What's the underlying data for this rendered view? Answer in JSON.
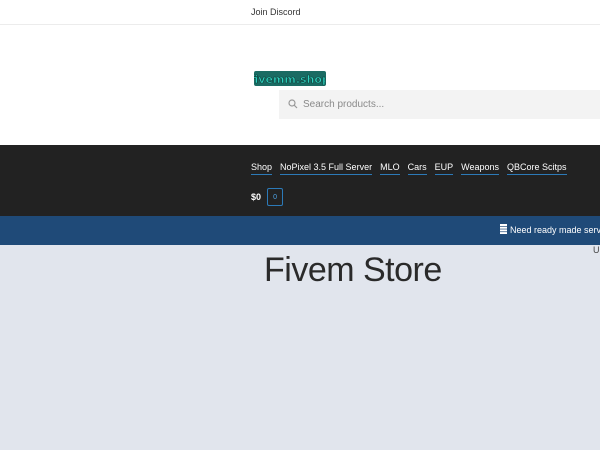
{
  "topbar": {
    "discord_label": "Join Discord"
  },
  "header": {
    "logo_text": "fivemm.shop",
    "search_placeholder": "Search products..."
  },
  "nav": {
    "items": [
      {
        "label": "Shop"
      },
      {
        "label": "NoPixel 3.5 Full Server"
      },
      {
        "label": "MLO"
      },
      {
        "label": "Cars"
      },
      {
        "label": "EUP"
      },
      {
        "label": "Weapons"
      },
      {
        "label": "QBCore Scitps"
      }
    ],
    "cart_amount": "$0",
    "cart_count": "0"
  },
  "notice": {
    "text": "Need ready made serve"
  },
  "main": {
    "stray_char": "U",
    "title": "Fivem Store"
  },
  "colors": {
    "nav_bg": "#222222",
    "notice_bg": "#1f4a78",
    "main_bg": "#e1e5ed",
    "accent": "#2c7ab8",
    "logo_fill": "#2ed3c0"
  }
}
